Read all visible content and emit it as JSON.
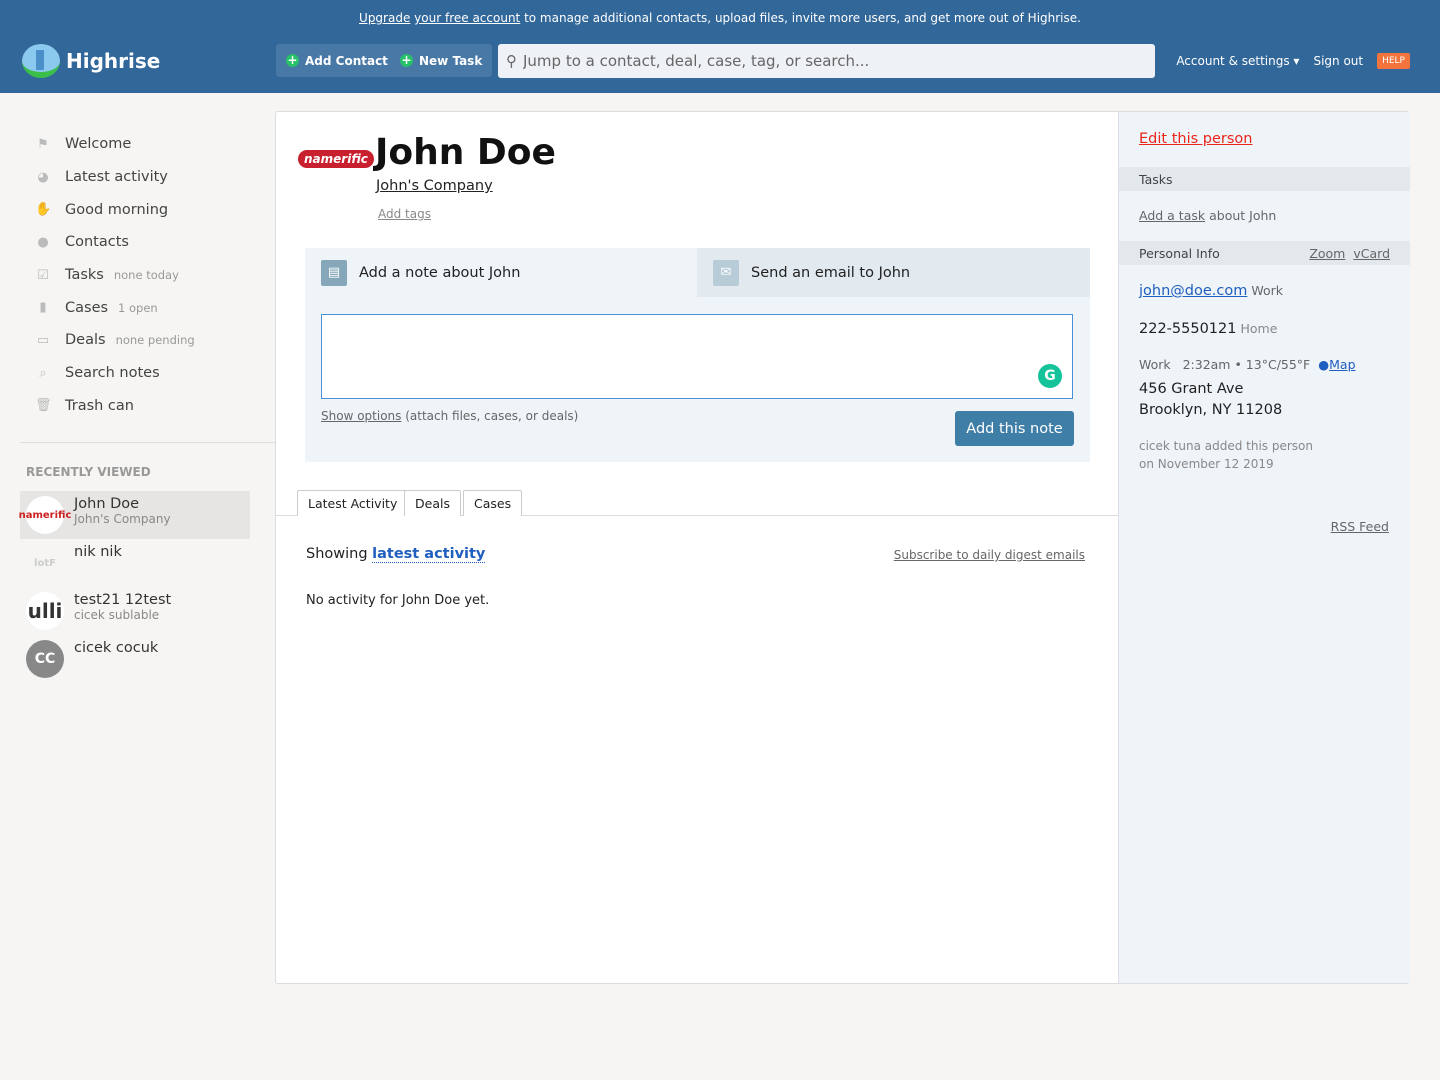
{
  "banner": {
    "link1": "Upgrade",
    "link2": "your free account",
    "rest": " to manage additional contacts, upload files, invite more users, and get more out of Highrise."
  },
  "header": {
    "app_name": "Highrise",
    "add_contact": "Add Contact",
    "new_task": "New Task",
    "search_placeholder": "Jump to a contact, deal, case, tag, or search...",
    "account": "Account & settings ▾",
    "sign_out": "Sign out",
    "help": "HELP"
  },
  "sidebar": {
    "items": [
      {
        "label": "Welcome",
        "icon": "⚑",
        "sub": ""
      },
      {
        "label": "Latest activity",
        "icon": "◕",
        "sub": ""
      },
      {
        "label": "Good morning",
        "icon": "✋",
        "sub": ""
      },
      {
        "label": "Contacts",
        "icon": "●",
        "sub": ""
      },
      {
        "label": "Tasks",
        "icon": "☑",
        "sub": "none today"
      },
      {
        "label": "Cases",
        "icon": "▮",
        "sub": "1 open"
      },
      {
        "label": "Deals",
        "icon": "▭",
        "sub": "none pending"
      },
      {
        "label": "Search notes",
        "icon": "⌕",
        "sub": ""
      },
      {
        "label": "Trash can",
        "icon": "🗑",
        "sub": ""
      }
    ],
    "recent_title": "RECENTLY VIEWED",
    "recent": [
      {
        "name": "John Doe",
        "company": "John's Company",
        "avatar": "namerific"
      },
      {
        "name": "nik nik",
        "company": "",
        "avatar": "lotF"
      },
      {
        "name": "test21 12test",
        "company": "cicek sublable",
        "avatar": "ulli"
      },
      {
        "name": "cicek cocuk",
        "company": "",
        "avatar": "CC"
      }
    ]
  },
  "person": {
    "name": "John Doe",
    "logo": "namerific",
    "company": "John's Company",
    "add_tags": "Add tags"
  },
  "composer": {
    "note_tab": "Add a note about John",
    "email_tab": "Send an email to John",
    "show_options": "Show options",
    "options_hint": " (attach files, cases, or deals)",
    "add_note": "Add this note"
  },
  "tabs": [
    "Latest Activity",
    "Deals",
    "Cases"
  ],
  "activity": {
    "showing": "Showing ",
    "link": "latest activity",
    "subscribe": "Subscribe to daily digest emails",
    "empty": "No activity for John Doe yet."
  },
  "right": {
    "edit": "Edit this person",
    "tasks_head": "Tasks",
    "add_task": "Add a task",
    "about": " about John",
    "info_head": "Personal Info",
    "zoom": "Zoom",
    "vcard": "vCard",
    "email": "john@doe.com",
    "email_type": "Work",
    "phone": "222-5550121",
    "phone_type": "Home",
    "addr_type": "Work",
    "time": "2:32am • 13°C/55°F",
    "map": "Map",
    "addr1": "456 Grant Ave",
    "addr2": "Brooklyn, NY 11208",
    "added1": "cicek tuna added this person",
    "added2": "on November 12 2019",
    "rss": "RSS Feed"
  }
}
